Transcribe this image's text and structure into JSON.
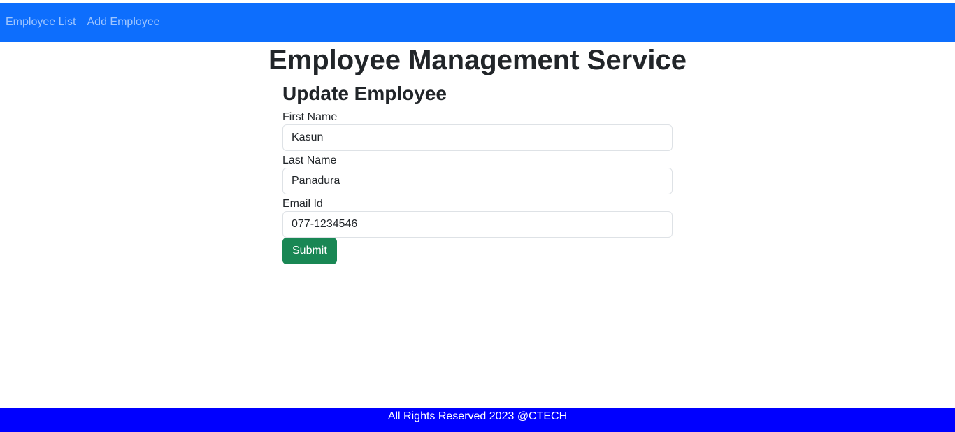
{
  "navbar": {
    "links": [
      {
        "label": "Employee List"
      },
      {
        "label": "Add Employee"
      }
    ],
    "background_color": "#0d6efd"
  },
  "main": {
    "title": "Employee Management Service"
  },
  "form": {
    "title": "Update Employee",
    "fields": [
      {
        "label": "First Name",
        "value": "Kasun"
      },
      {
        "label": "Last Name",
        "value": "Panadura"
      },
      {
        "label": "Email Id",
        "value": "077-1234546"
      }
    ],
    "submit_label": "Submit",
    "submit_color": "#198754"
  },
  "footer": {
    "text": "All Rights Reserved 2023 @CTECH",
    "background_color": "#0000ff"
  }
}
